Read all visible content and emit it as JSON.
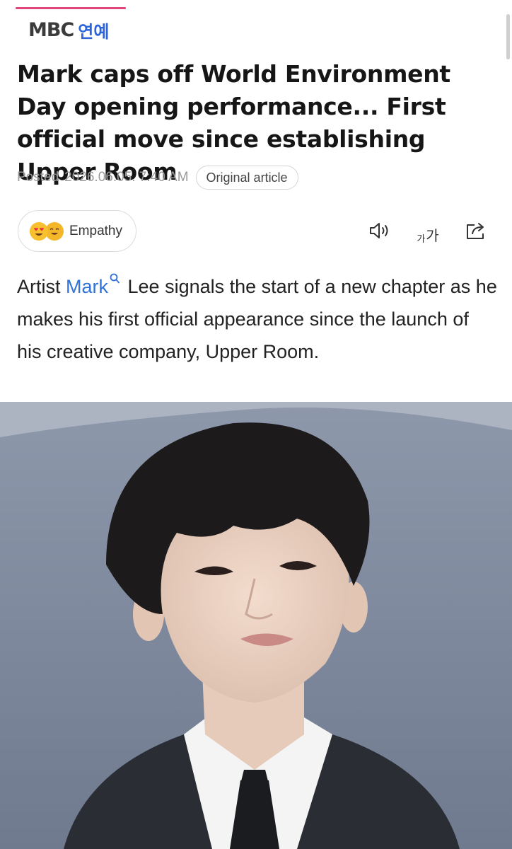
{
  "header": {
    "brand_logo": "MBC",
    "brand_sub": "연예"
  },
  "article": {
    "headline": "Mark caps off World Environment Day opening performance... First official move since establishing Upper Room",
    "posted_label": "Posted",
    "posted_datetime": "2026.06.05. 7:40 AM",
    "original_article_label": "Original article",
    "lead_before": "Artist ",
    "lead_link": "Mark",
    "lead_after": " Lee signals the start of a new chapter as he makes his first official appearance since the launch of his creative company, Upper Room."
  },
  "reactions": {
    "empathy_label": "Empathy",
    "emoji_icons": [
      "heart-eyes-emoji-icon",
      "grin-emoji-icon"
    ]
  },
  "toolbar": {
    "font_small": "가",
    "font_big": "가",
    "icons": [
      "speaker-icon",
      "font-size-icon",
      "share-icon"
    ]
  },
  "colors": {
    "accent_pink": "#e0447a",
    "brand_blue": "#2b63d9",
    "link_blue": "#2f72d8",
    "muted_gray": "#9a9a9a"
  }
}
